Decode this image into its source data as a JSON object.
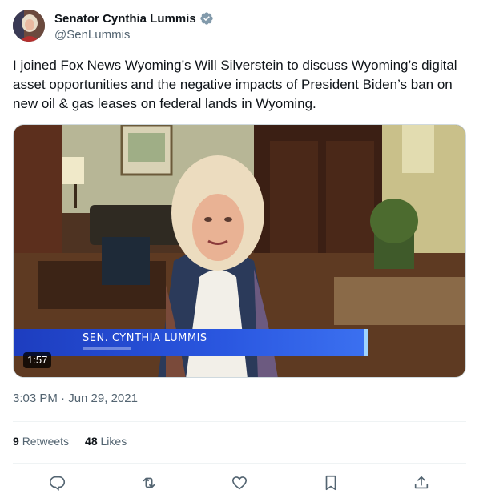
{
  "author": {
    "name": "Senator Cynthia Lummis",
    "handle": "@SenLummis",
    "verified_icon": "verified-badge-icon"
  },
  "tweet": {
    "text": "I joined Fox News Wyoming’s Will Silverstein to discuss Wyoming’s digital asset opportunities and the negative impacts of President Biden’s ban on new oil & gas leases on federal lands in Wyoming."
  },
  "media": {
    "duration": "1:57",
    "lower_third": "SEN. CYNTHIA LUMMIS"
  },
  "meta": {
    "timestamp": "3:03 PM · Jun 29, 2021"
  },
  "stats": {
    "retweets_count": "9",
    "retweets_label": "Retweets",
    "likes_count": "48",
    "likes_label": "Likes"
  },
  "actions": [
    "reply-icon",
    "retweet-icon",
    "like-icon",
    "bookmark-icon",
    "share-icon"
  ],
  "colors": {
    "text": "#0f1419",
    "secondary": "#536471",
    "verified": "#829aab",
    "divider": "#eff3f4"
  }
}
